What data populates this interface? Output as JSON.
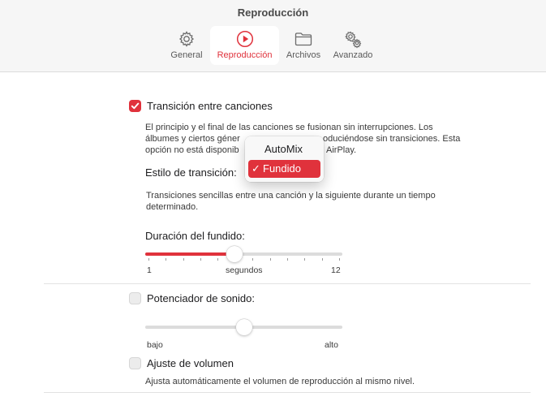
{
  "window": {
    "title": "Reproducción"
  },
  "tabs": [
    {
      "label": "General",
      "icon": "gear-icon"
    },
    {
      "label": "Reproducción",
      "icon": "play-circle-icon",
      "active": true
    },
    {
      "label": "Archivos",
      "icon": "folder-icon"
    },
    {
      "label": "Avanzado",
      "icon": "gears-icon"
    }
  ],
  "crossfade": {
    "label": "Transición entre canciones",
    "checked": true,
    "description_lines": [
      "El principio y el final de las canciones se fusionan sin interrupciones. Los",
      "álbumes y ciertos géner",
      "oduciéndose sin transiciones. Esta",
      "opción no está disponib",
      "AirPlay."
    ],
    "style_label": "Estilo de transición:",
    "style_help_lines": [
      "Transiciones sencillas entre una canción y la siguiente durante un tiempo",
      "determinado."
    ],
    "duration_label": "Duración del fundido:",
    "duration_min": "1",
    "duration_unit": "segundos",
    "duration_max": "12",
    "duration_value": 6
  },
  "style_menu": {
    "options": [
      "AutoMix",
      "Fundido"
    ],
    "selected": "Fundido",
    "check_glyph": "✓"
  },
  "sound_enhancer": {
    "label": "Potenciador de sonido:",
    "checked": false,
    "min_label": "bajo",
    "max_label": "alto",
    "level_fraction": 0.5
  },
  "sound_check": {
    "label": "Ajuste de volumen",
    "checked": false,
    "description": "Ajusta automáticamente el volumen de reproducción al mismo nivel."
  },
  "colors": {
    "accent": "#e0323c",
    "track": "#dcdcdc"
  }
}
